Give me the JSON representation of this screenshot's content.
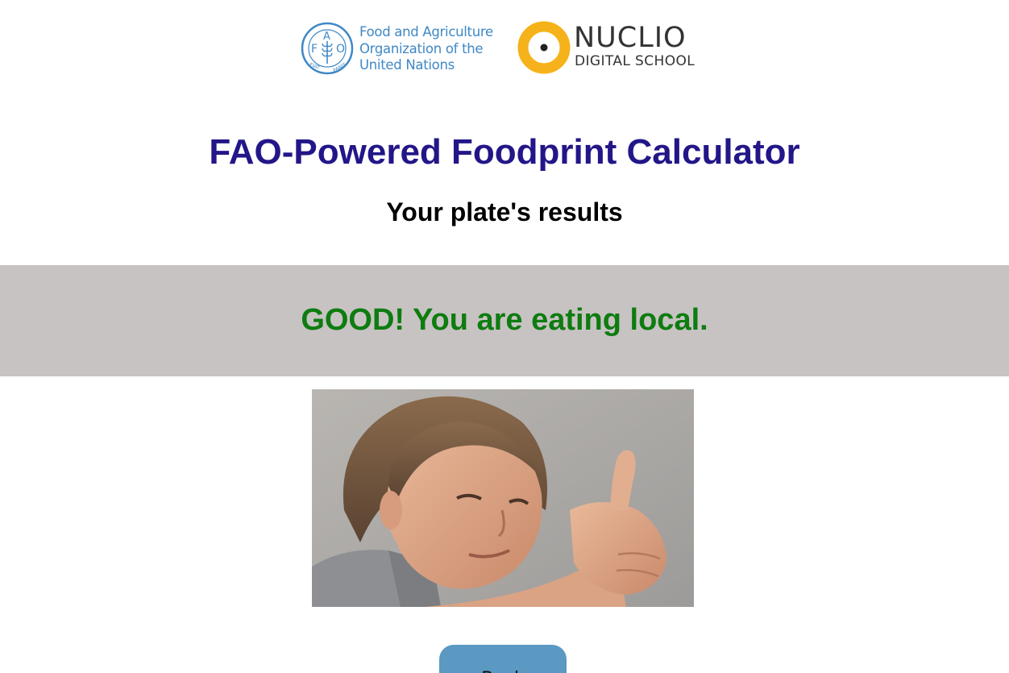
{
  "header": {
    "fao_logo": {
      "line1": "Food and Agriculture",
      "line2": "Organization of the",
      "line3": "United Nations",
      "emblem_icon": "fao-wheat-emblem-icon",
      "emblem_text": "FIAT PANIS",
      "color": "#3f88c5"
    },
    "nuclio_logo": {
      "name": "NUCLIO",
      "subtitle": "DIGITAL SCHOOL",
      "emblem_icon": "nuclio-ring-icon",
      "ring_color": "#f6b21b"
    }
  },
  "main": {
    "title": "FAO-Powered Foodprint Calculator",
    "subtitle": "Your plate's results",
    "title_color": "#221688"
  },
  "result": {
    "message": "GOOD! You are eating local.",
    "message_color": "#0e7c10",
    "band_color": "#c8c3c3"
  },
  "photo": {
    "subject": "person-giving-thumbs-up"
  },
  "actions": {
    "back_label": "Back",
    "back_color": "#5b98c2"
  }
}
